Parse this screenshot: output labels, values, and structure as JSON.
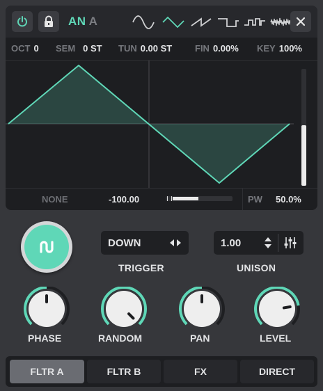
{
  "header": {
    "osc_label_main": "AN",
    "osc_label_sub": "A",
    "waveforms": [
      "sine",
      "triangle",
      "saw",
      "square",
      "pulse",
      "noise"
    ],
    "selected_waveform": "triangle",
    "power_on": true
  },
  "params": {
    "oct_label": "OCT",
    "oct_value": "0",
    "sem_label": "SEM",
    "sem_value": "0 ST",
    "tun_label": "TUN",
    "tun_value": "0.00 ST",
    "fin_label": "FIN",
    "fin_value": "0.00%",
    "key_label": "KEY",
    "key_value": "100%"
  },
  "display": {
    "level_meter": 0.52
  },
  "footer": {
    "mod_label": "NONE",
    "mod_value": "-100.00",
    "mod_slider_fraction": 0.42,
    "pw_label": "PW",
    "pw_value": "50.0%"
  },
  "trigger": {
    "value": "DOWN",
    "label": "TRIGGER"
  },
  "unison": {
    "value": "1.00",
    "label": "UNISON"
  },
  "knobs": [
    {
      "label": "PHASE",
      "value": 0.5
    },
    {
      "label": "RANDOM",
      "value": 1.0
    },
    {
      "label": "PAN",
      "value": 0.5
    },
    {
      "label": "LEVEL",
      "value": 0.8
    }
  ],
  "tabs": [
    {
      "label": "FLTR A",
      "active": true
    },
    {
      "label": "FLTR B",
      "active": false
    },
    {
      "label": "FX",
      "active": false
    },
    {
      "label": "DIRECT",
      "active": false
    }
  ],
  "colors": {
    "accent": "#5fd7b7",
    "panel": "#1d1e21",
    "background": "#36373b"
  }
}
